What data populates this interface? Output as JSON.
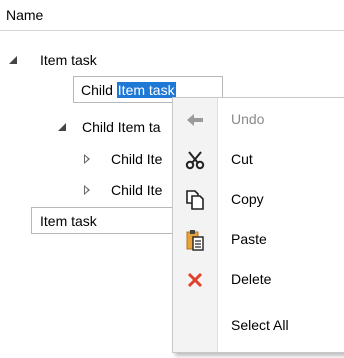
{
  "header": {
    "column_name": "Name"
  },
  "tree": {
    "root_item": "Item task",
    "editing_child_prefix": "Child ",
    "editing_child_selected": "Item task",
    "child_item": "Child Item ta",
    "grandchild_1": "Child Ite",
    "grandchild_2": "Child Ite",
    "root_item_2": "Item task"
  },
  "menu": {
    "undo": "Undo",
    "cut": "Cut",
    "copy": "Copy",
    "paste": "Paste",
    "delete": "Delete",
    "select_all": "Select All"
  },
  "icons": {
    "undo": "undo-arrow-icon",
    "cut": "scissors-icon",
    "copy": "copy-icon",
    "paste": "paste-icon",
    "delete": "delete-x-icon"
  },
  "colors": {
    "selection": "#1e78d6",
    "delete_icon": "#e0402a",
    "disabled_text": "#8a8a8a"
  }
}
